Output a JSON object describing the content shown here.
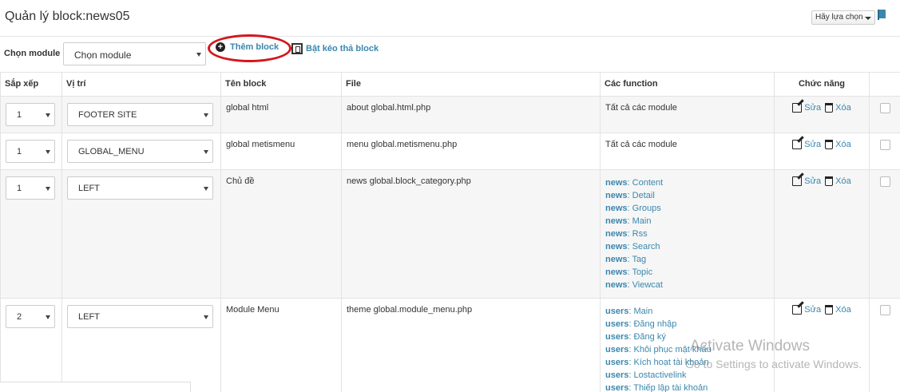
{
  "header": {
    "title": "Quản lý block:news05",
    "select_label": "Hãy lựa chọn"
  },
  "toolbar": {
    "module_label": "Chọn module",
    "module_value": "Chọn module",
    "add_label": "Thêm block",
    "drag_label": "Bật kéo thả block"
  },
  "table": {
    "columns": [
      "Sắp xếp",
      "Vị trí",
      "Tên block",
      "File",
      "Các function",
      "Chức năng"
    ],
    "edit_label": "Sửa",
    "delete_label": "Xóa",
    "rows": [
      {
        "order": "1",
        "position": "FOOTER SITE",
        "name": "global html",
        "file": "about global.html.php",
        "functions_text": "Tất cả các module"
      },
      {
        "order": "1",
        "position": "GLOBAL_MENU",
        "name": "global metismenu",
        "file": "menu global.metismenu.php",
        "functions_text": "Tất cả các module"
      },
      {
        "order": "1",
        "position": "LEFT",
        "name": "Chủ đề",
        "file": "news global.block_category.php",
        "functions": [
          {
            "module": "news",
            "name": "Content"
          },
          {
            "module": "news",
            "name": "Detail"
          },
          {
            "module": "news",
            "name": "Groups"
          },
          {
            "module": "news",
            "name": "Main"
          },
          {
            "module": "news",
            "name": "Rss"
          },
          {
            "module": "news",
            "name": "Search"
          },
          {
            "module": "news",
            "name": "Tag"
          },
          {
            "module": "news",
            "name": "Topic"
          },
          {
            "module": "news",
            "name": "Viewcat"
          }
        ]
      },
      {
        "order": "2",
        "position": "LEFT",
        "name": "Module Menu",
        "file": "theme global.module_menu.php",
        "functions": [
          {
            "module": "users",
            "name": "Main"
          },
          {
            "module": "users",
            "name": "Đăng nhập"
          },
          {
            "module": "users",
            "name": "Đăng ký"
          },
          {
            "module": "users",
            "name": "Khôi phục mật khẩu"
          },
          {
            "module": "users",
            "name": "Kích hoạt tài khoản"
          },
          {
            "module": "users",
            "name": "Lostactivelink"
          },
          {
            "module": "users",
            "name": "Thiếp lập tài khoản"
          }
        ]
      }
    ]
  },
  "watermark": {
    "line1": "Activate Windows",
    "line2": "Go to Settings to activate Windows."
  }
}
